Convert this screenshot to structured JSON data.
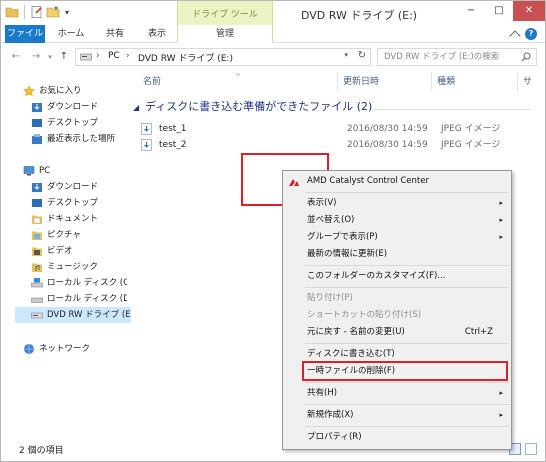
{
  "window": {
    "title": "DVD RW ドライブ (E:)",
    "contextual_group": "ドライブ ツール",
    "controls": {
      "minimize": "−",
      "maximize": "□",
      "close": "✕"
    }
  },
  "ribbon": {
    "tabs": [
      "ファイル",
      "ホーム",
      "共有",
      "表示",
      "管理"
    ],
    "help": "?"
  },
  "address": {
    "back": "←",
    "forward": "→",
    "up": "↑",
    "separator": "›",
    "crumbs": [
      "PC",
      "DVD RW ドライブ (E:)"
    ],
    "search_placeholder": "DVD RW ドライブ (E:)の検索"
  },
  "nav": {
    "favorites": {
      "label": "お気に入り",
      "items": [
        "ダウンロード",
        "デスクトップ",
        "最近表示した場所"
      ]
    },
    "pc": {
      "label": "PC",
      "items": [
        "ダウンロード",
        "デスクトップ",
        "ドキュメント",
        "ピクチャ",
        "ビデオ",
        "ミュージック",
        "ローカル ディスク (C:)",
        "ローカル ディスク (D:)",
        "DVD RW ドライブ (E"
      ]
    },
    "network": {
      "label": "ネットワーク"
    }
  },
  "columns": {
    "name": "名前",
    "date": "更新日時",
    "type": "種類",
    "size": "サ"
  },
  "group": {
    "label": "ディスクに書き込む準備ができたファイル (2)",
    "files": [
      {
        "name": "test_1",
        "date": "2016/08/30 14:59",
        "type": "JPEG イメージ"
      },
      {
        "name": "test_2",
        "date": "2016/08/30 14:59",
        "type": "JPEG イメージ"
      }
    ]
  },
  "status": {
    "count": "2 個の項目"
  },
  "context_menu": {
    "items": [
      {
        "label": "AMD Catalyst Control Center"
      },
      {
        "label": "表示(V)",
        "submenu": true
      },
      {
        "label": "並べ替え(O)",
        "submenu": true
      },
      {
        "label": "グループで表示(P)",
        "submenu": true
      },
      {
        "label": "最新の情報に更新(E)"
      },
      {
        "label": "このフォルダーのカスタマイズ(F)..."
      },
      {
        "label": "貼り付け(P)",
        "disabled": true
      },
      {
        "label": "ショートカットの貼り付け(S)",
        "disabled": true
      },
      {
        "label": "元に戻す - 名前の変更(U)",
        "shortcut": "Ctrl+Z"
      },
      {
        "label": "ディスクに書き込む(T)"
      },
      {
        "label": "一時ファイルの削除(F)"
      },
      {
        "label": "共有(H)",
        "submenu": true
      },
      {
        "label": "新規作成(X)",
        "submenu": true
      },
      {
        "label": "プロパティ(R)"
      }
    ],
    "submenu_glyph": "▸"
  },
  "colors": {
    "file_tab": "#1979ca",
    "contextual_tab": "#e9f3c3",
    "highlight": "#d9222a",
    "selection": "#cce8ff"
  }
}
